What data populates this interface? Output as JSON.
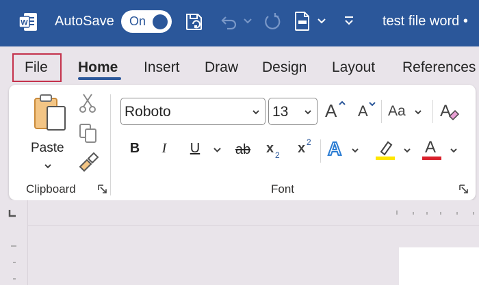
{
  "titlebar": {
    "autosave_label": "AutoSave",
    "toggle_label": "On",
    "doc_title": "test file word •"
  },
  "tabs": [
    {
      "label": "File"
    },
    {
      "label": "Home"
    },
    {
      "label": "Insert"
    },
    {
      "label": "Draw"
    },
    {
      "label": "Design"
    },
    {
      "label": "Layout"
    },
    {
      "label": "References"
    }
  ],
  "clipboard": {
    "paste_label": "Paste",
    "group_label": "Clipboard"
  },
  "font": {
    "font_name": "Roboto",
    "font_size": "13",
    "group_label": "Font",
    "change_case": "Aa",
    "bold": "B",
    "italic": "I",
    "underline": "U",
    "strike": "ab",
    "subscript": "x",
    "subscript_mark": "2",
    "superscript": "x",
    "superscript_mark": "2",
    "grow": "A",
    "shrink": "A",
    "effects": "A",
    "font_color": "A"
  },
  "colors": {
    "titlebar": "#2b579a",
    "highlight": "#ffe600",
    "font_color": "#d9202b",
    "file_outline": "#c4314b"
  }
}
